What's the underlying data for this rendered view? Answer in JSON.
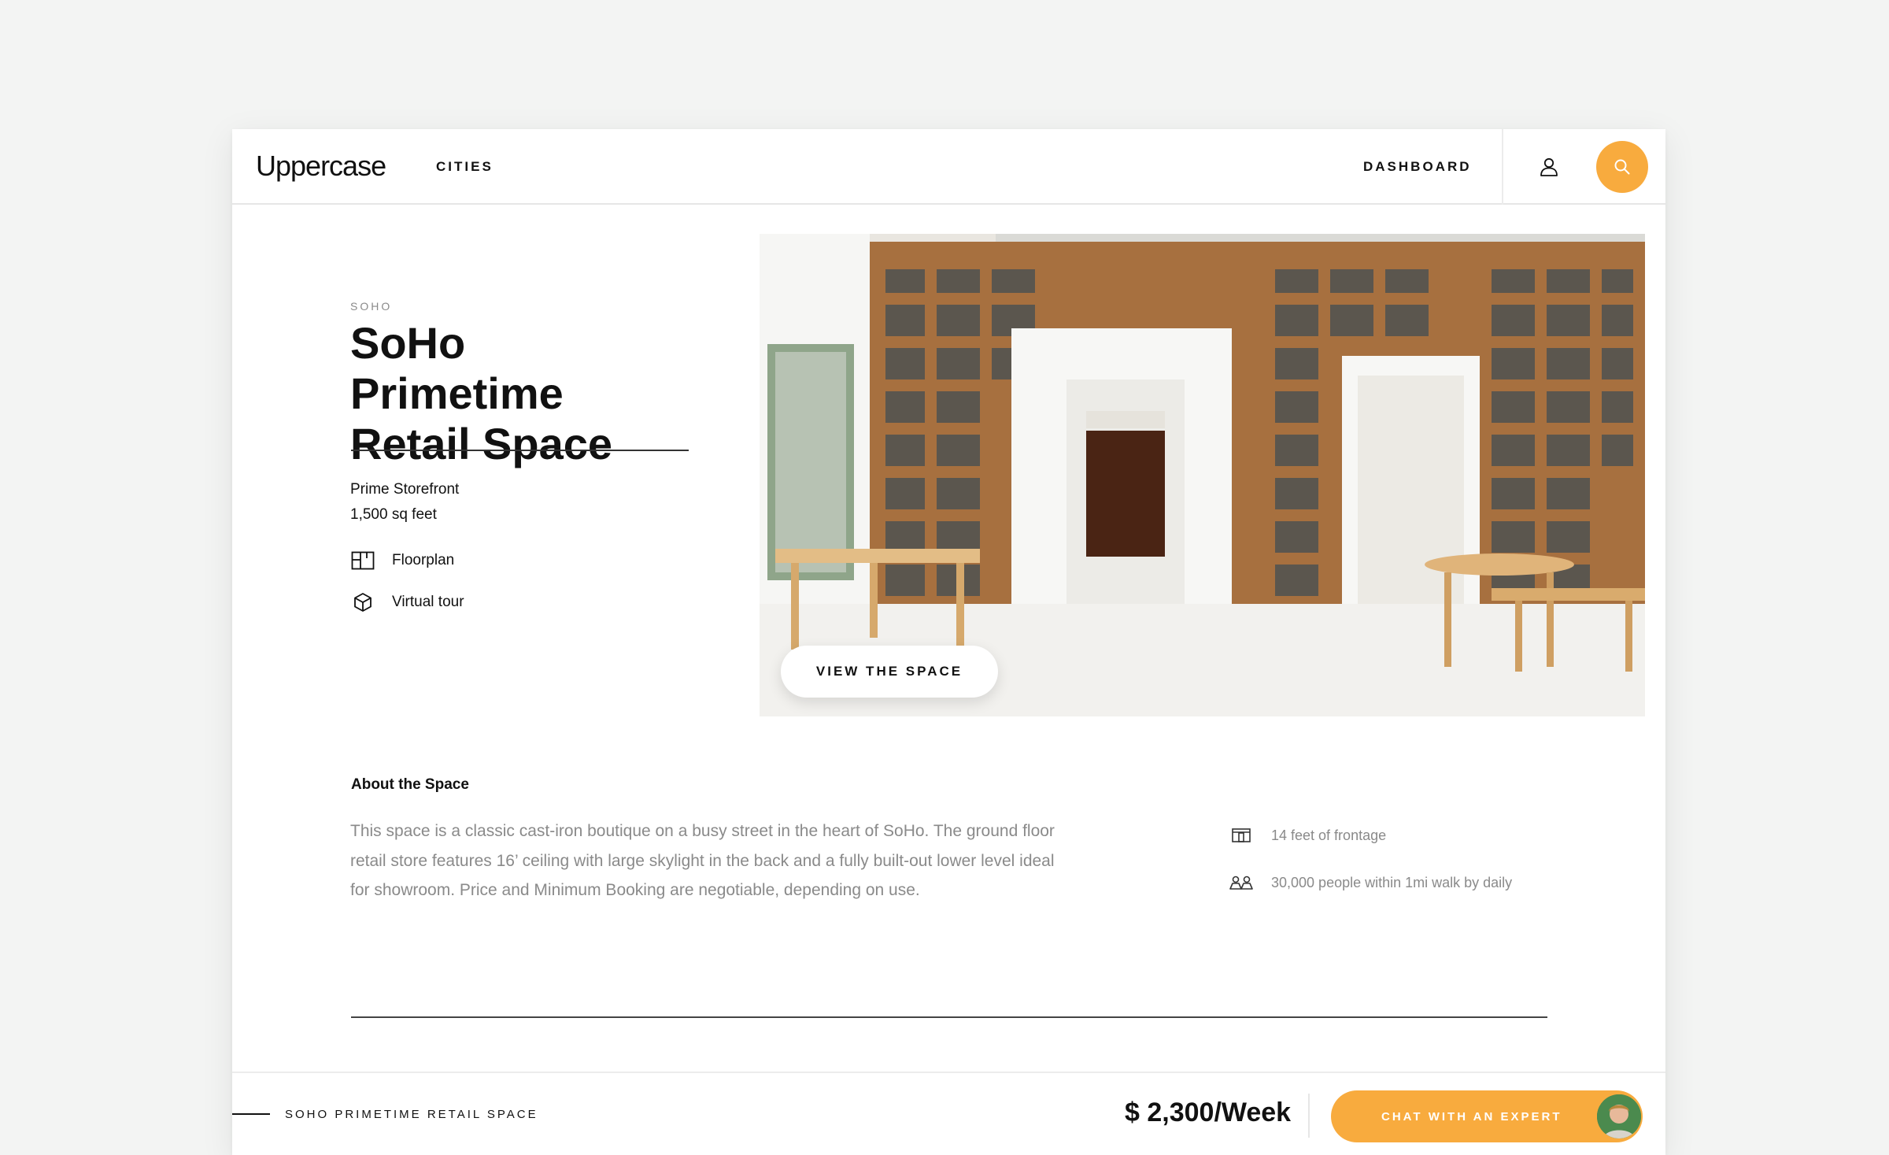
{
  "nav": {
    "logo": "Uppercase",
    "cities_label": "CITIES",
    "dashboard_label": "DASHBOARD"
  },
  "listing": {
    "eyebrow": "SOHO",
    "title": "SoHo Primetime Retail Space",
    "type": "Prime Storefront",
    "size": "1,500 sq feet",
    "features": [
      {
        "icon": "floorplan-icon",
        "label": "Floorplan"
      },
      {
        "icon": "cube-icon",
        "label": "Virtual tour"
      }
    ],
    "view_button": "VIEW THE SPACE"
  },
  "about": {
    "heading": "About the Space",
    "text": "This space is a classic cast-iron boutique on a busy street in the heart of SoHo. The ground floor retail store features 16’ ceiling with large skylight in the back and a fully built-out lower level ideal for showroom. Price and Minimum Booking are negotiable, depending on use.",
    "stats": [
      {
        "icon": "storefront-icon",
        "label": "14 feet of frontage"
      },
      {
        "icon": "people-icon",
        "label": "30,000 people within 1mi walk by daily"
      }
    ]
  },
  "footer": {
    "title": "SOHO PRIMETIME RETAIL SPACE",
    "price": "$ 2,300/Week",
    "chat_button": "CHAT WITH AN EXPERT"
  },
  "colors": {
    "accent": "#f8ab3e",
    "background": "#f3f4f3",
    "muted_text": "#8a8a8a"
  }
}
